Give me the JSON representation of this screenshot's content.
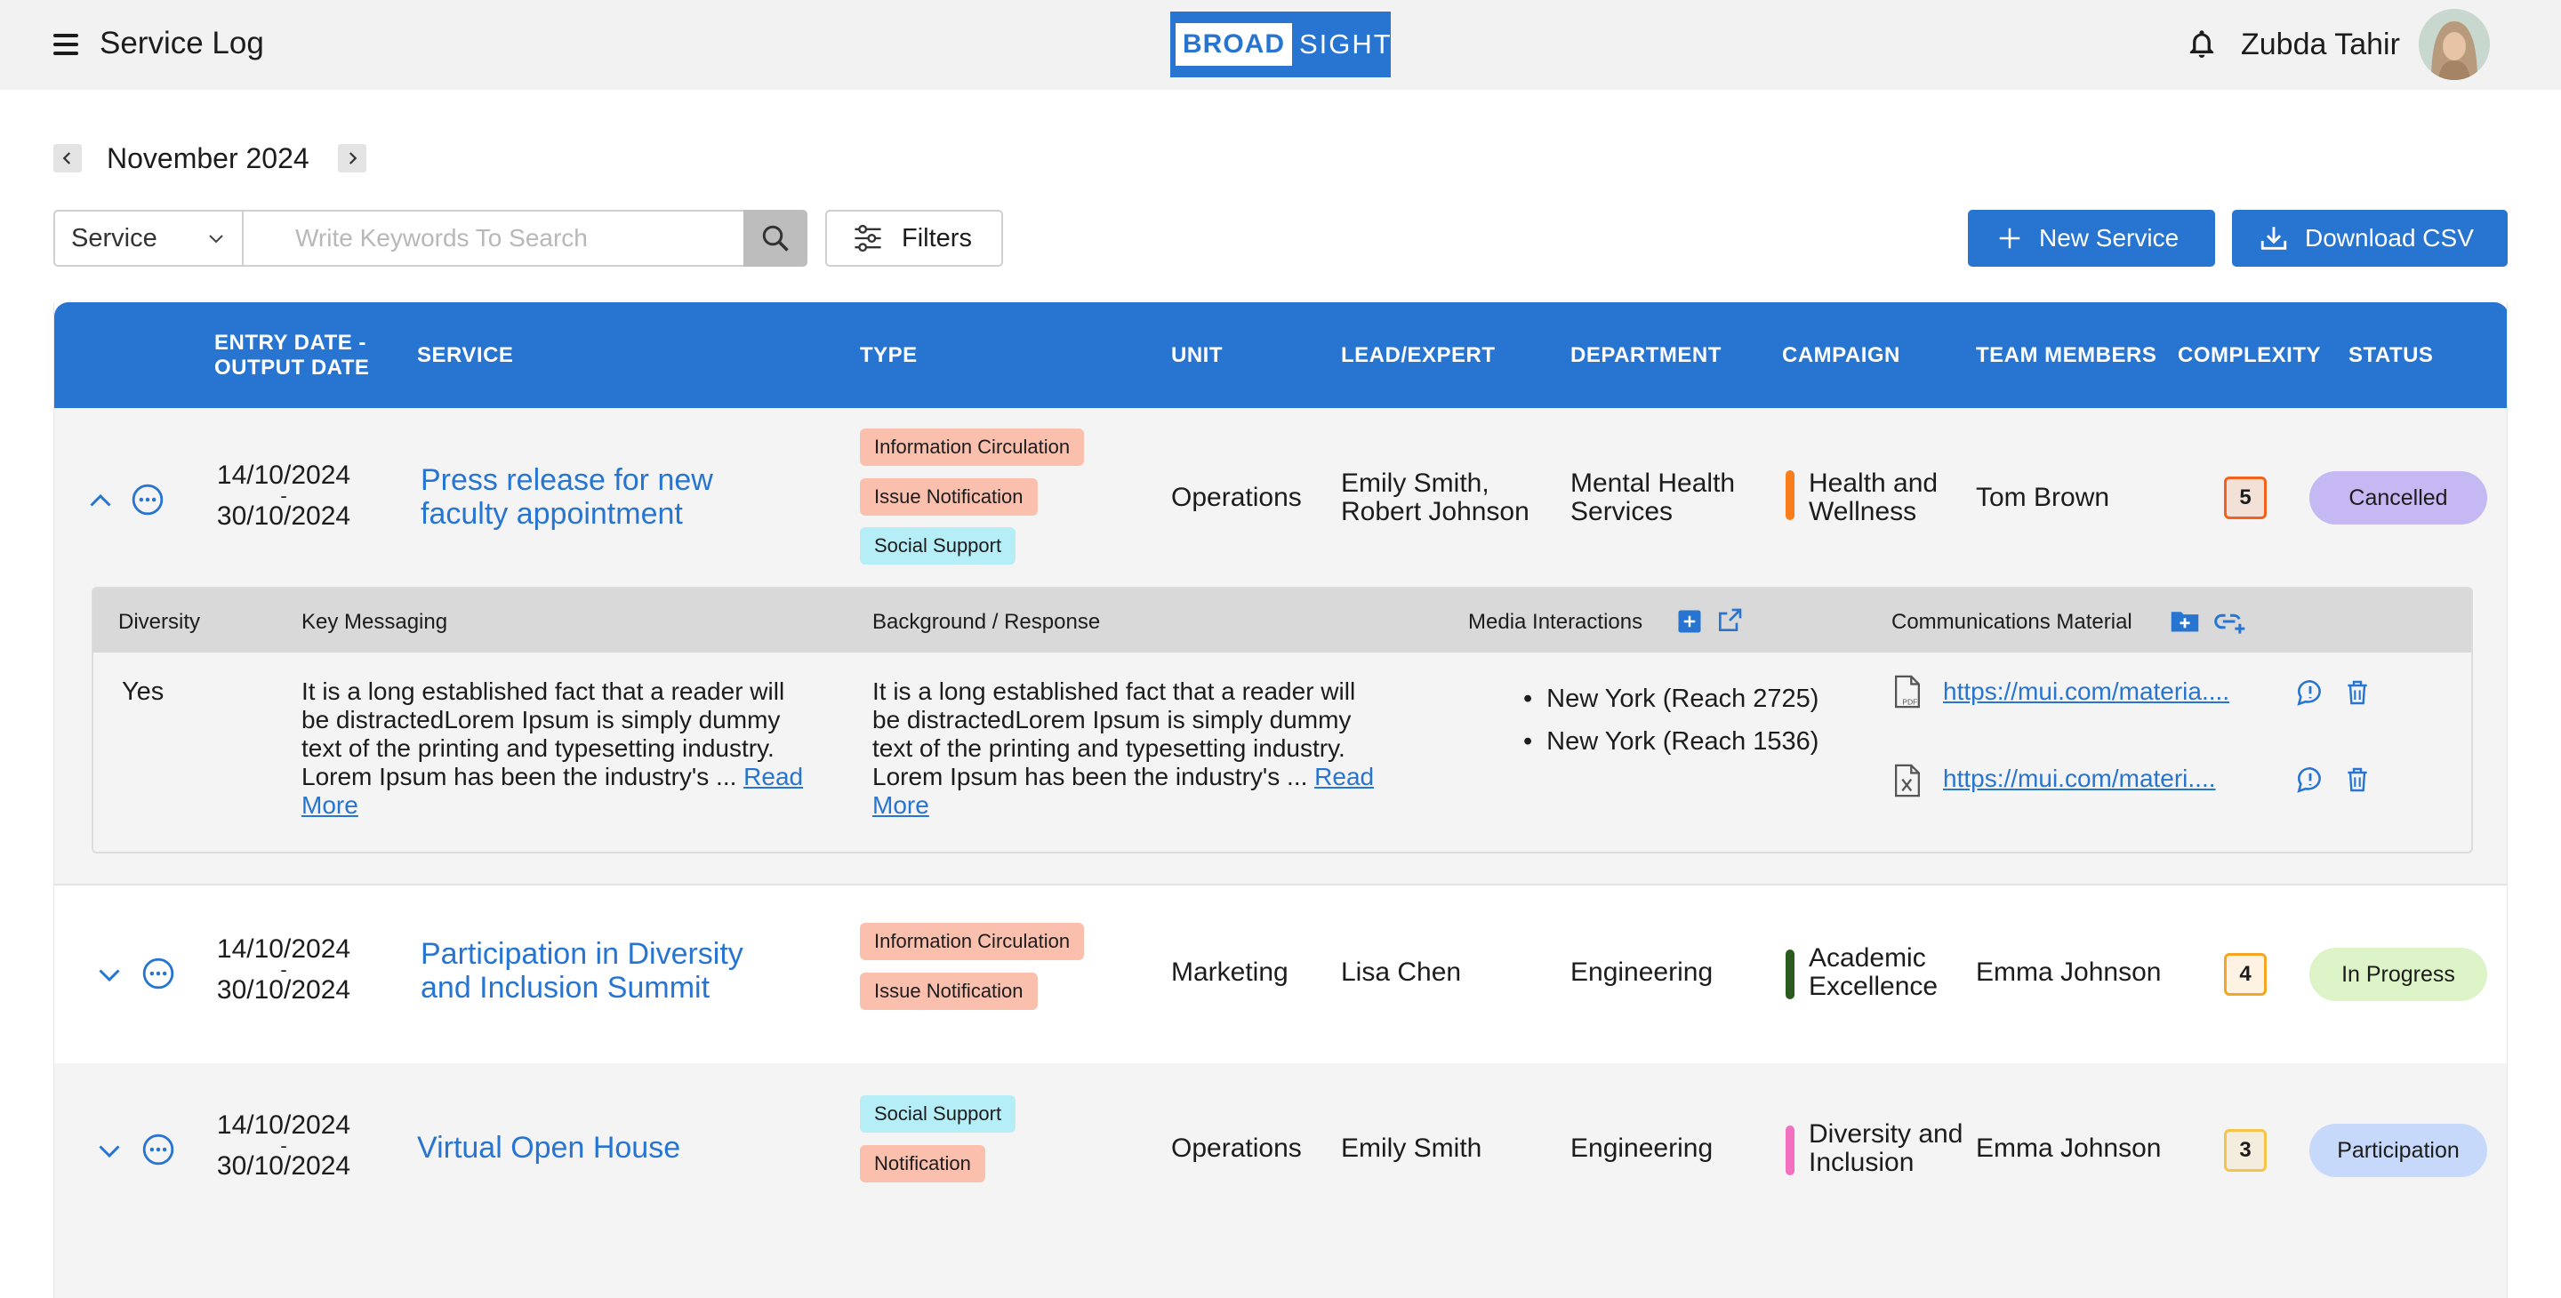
{
  "header": {
    "title": "Service Log",
    "logo_left": "BROAD",
    "logo_right": "SIGHT",
    "user_name": "Zubda Tahir"
  },
  "month_nav": {
    "label": "November 2024"
  },
  "toolbar": {
    "select_value": "Service",
    "search_placeholder": "Write Keywords To Search",
    "filters_label": "Filters",
    "new_service_label": "New Service",
    "download_csv_label": "Download CSV"
  },
  "table": {
    "columns": {
      "date_line1": "ENTRY DATE -",
      "date_line2": "OUTPUT DATE",
      "service": "SERVICE",
      "type": "TYPE",
      "unit": "UNIT",
      "lead": "LEAD/EXPERT",
      "department": "DEPARTMENT",
      "campaign": "CAMPAIGN",
      "team": "TEAM MEMBERS",
      "complexity": "COMPLEXITY",
      "status": "STATUS"
    },
    "rows": [
      {
        "entry_date": "14/10/2024",
        "date_sep": "-",
        "output_date": "30/10/2024",
        "service_line1": "Press release for new",
        "service_line2": "faculty appointment",
        "types": [
          "Information Circulation",
          "Issue Notification",
          "Social Support"
        ],
        "unit": "Operations",
        "lead_line1": "Emily Smith,",
        "lead_line2": "Robert Johnson",
        "department_line1": "Mental Health",
        "department_line2": "Services",
        "campaign_line1": "Health and",
        "campaign_line2": "Wellness",
        "campaign_color": "#f97d1b",
        "team": "Tom Brown",
        "complexity": "5",
        "complexity_color": "#f2611d",
        "status": "Cancelled",
        "status_color": "#c6b8f2",
        "expanded": true
      },
      {
        "entry_date": "14/10/2024",
        "date_sep": "-",
        "output_date": "30/10/2024",
        "service_line1": "Participation in Diversity",
        "service_line2": "and Inclusion Summit",
        "types": [
          "Information Circulation",
          "Issue Notification"
        ],
        "unit": "Marketing",
        "lead": "Lisa Chen",
        "department": "Engineering",
        "campaign_line1": "Academic",
        "campaign_line2": "Excellence",
        "campaign_color": "#2b5a1f",
        "team": "Emma Johnson",
        "complexity": "4",
        "complexity_color": "#f7a623",
        "status": "In Progress",
        "status_color": "#ddf3c8",
        "expanded": false
      },
      {
        "entry_date": "14/10/2024",
        "date_sep": "-",
        "output_date": "30/10/2024",
        "service": "Virtual Open House",
        "types": [
          "Social Support",
          "Notification"
        ],
        "unit": "Operations",
        "lead": "Emily Smith",
        "department": "Engineering",
        "campaign_line1": "Diversity and",
        "campaign_line2": "Inclusion",
        "campaign_color": "#f36fbf",
        "team": "Emma Johnson",
        "complexity": "3",
        "complexity_color": "#f7c44a",
        "status": "Participation",
        "status_color": "#c7d9fb",
        "expanded": false
      }
    ]
  },
  "detail": {
    "headers": {
      "diversity": "Diversity",
      "key_messaging": "Key Messaging",
      "background": "Background / Response",
      "media": "Media Interactions",
      "materials": "Communications Material"
    },
    "diversity": "Yes",
    "key_messaging": "It is a long established fact that a reader will be distractedLorem Ipsum is simply dummy text of the printing and typesetting industry. Lorem Ipsum has been the industry's ...",
    "background": "It is a long established fact that a reader will be distractedLorem Ipsum is simply dummy text of the printing and typesetting industry. Lorem Ipsum has been the industry's ...",
    "read_more": "Read More",
    "media": [
      "New York (Reach 2725)",
      "New York (Reach 1536)"
    ],
    "materials": [
      {
        "link": "https://mui.com/materia....",
        "icon": "pdf-file-icon"
      },
      {
        "link": "https://mui.com/materi....",
        "icon": "excel-file-icon"
      }
    ]
  }
}
